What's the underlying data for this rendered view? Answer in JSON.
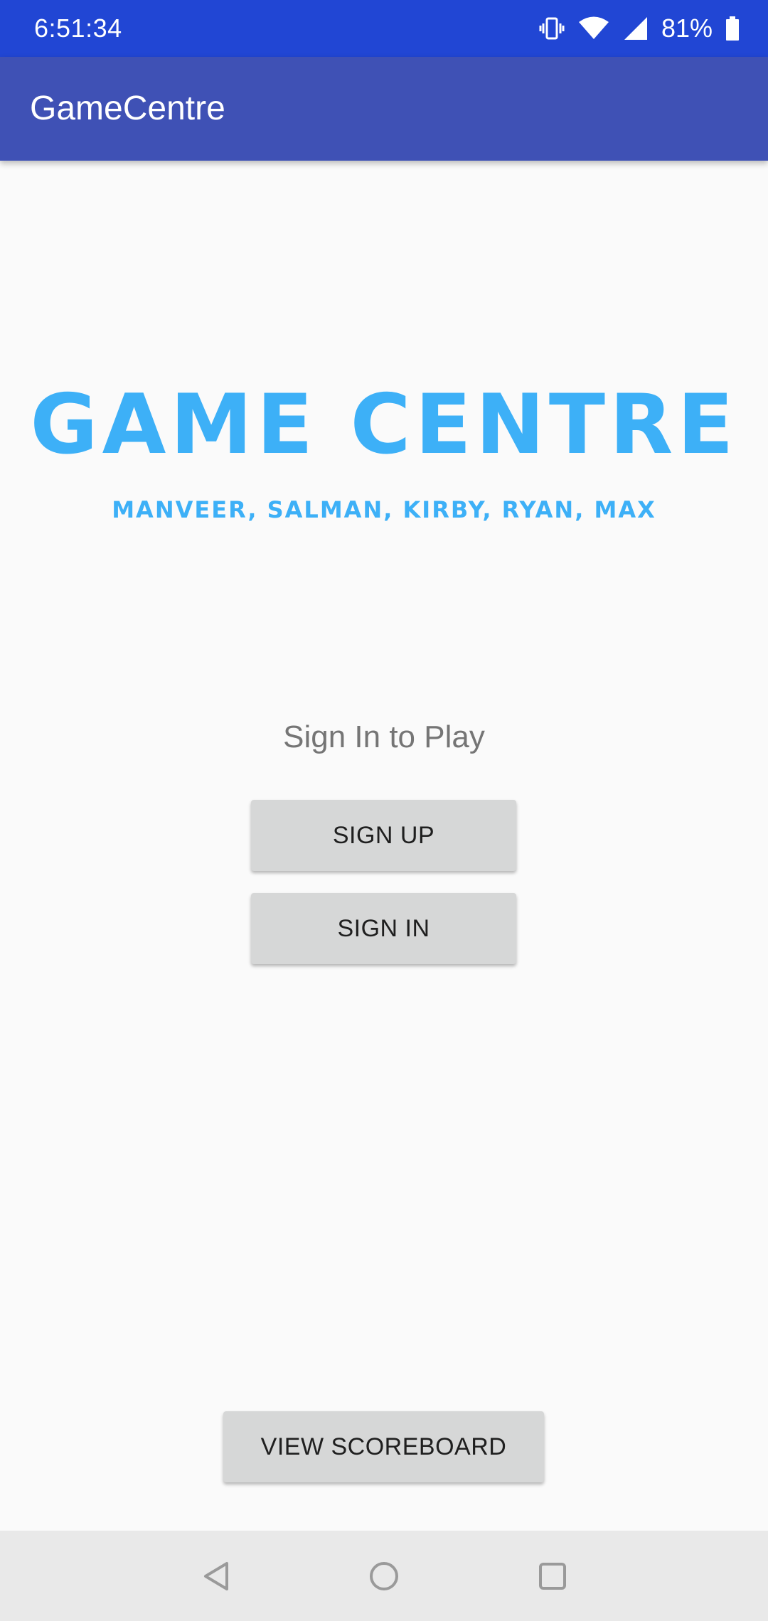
{
  "status_bar": {
    "time": "6:51:34",
    "battery_percent": "81%",
    "icons": [
      "vibrate-icon",
      "wifi-icon",
      "cell-signal-icon",
      "battery-icon"
    ]
  },
  "app_bar": {
    "title": "GameCentre"
  },
  "logo": {
    "title": "GAME CENTRE",
    "subtitle": "MANVEER, SALMAN, KIRBY, RYAN, MAX"
  },
  "main": {
    "prompt": "Sign In to Play",
    "sign_up_label": "SIGN UP",
    "sign_in_label": "SIGN IN",
    "scoreboard_label": "VIEW SCOREBOARD"
  },
  "nav_bar": {
    "icons": [
      "back-icon",
      "home-icon",
      "recents-icon"
    ]
  },
  "colors": {
    "status_bar": "#2146d4",
    "app_bar": "#3f51b5",
    "logo": "#3db0f7",
    "background": "#fafafa",
    "button": "#d6d7d7",
    "nav_bar": "#e9e9e9"
  }
}
